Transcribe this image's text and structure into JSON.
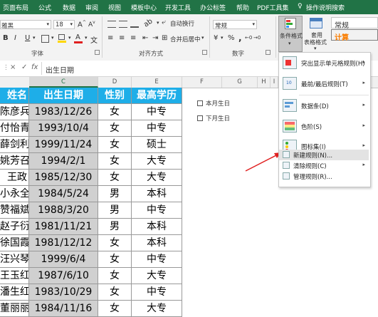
{
  "tabs": [
    "页面布局",
    "公式",
    "数据",
    "审阅",
    "视图",
    "模板中心",
    "开发工具",
    "办公标签",
    "帮助",
    "PDF工具集",
    "操作说明搜索"
  ],
  "ribbon": {
    "font_name": "雅黑",
    "font_size": "18",
    "bold": "B",
    "italic": "I",
    "underline": "U",
    "wrap_text": "自动换行",
    "merge_center": "合并后居中",
    "number_format": "常规",
    "percent": "%",
    "thousands": ",",
    "cond_format": "条件格式",
    "table_format_1": "套用",
    "table_format_2": "表格格式",
    "style_normal": "常规",
    "style_calc": "计算",
    "groups": {
      "font": "字体",
      "alignment": "对齐方式",
      "number": "数字"
    }
  },
  "formula_bar": {
    "x": "×",
    "check": "✓",
    "fx": "fx",
    "content": "出生日期"
  },
  "col_headers": [
    "C",
    "D",
    "E",
    "F",
    "G",
    "H",
    "I"
  ],
  "table": {
    "headers": [
      "姓名",
      "出生日期",
      "性别",
      "最高学历"
    ],
    "rows": [
      [
        "陈彦兵",
        "1983/12/26",
        "女",
        "中专"
      ],
      [
        "付怡青",
        "1993/10/4",
        "女",
        "中专"
      ],
      [
        "薛剑利",
        "1999/11/24",
        "女",
        "硕士"
      ],
      [
        "姚芳召",
        "1994/2/1",
        "女",
        "大专"
      ],
      [
        "王政",
        "1985/12/30",
        "女",
        "大专"
      ],
      [
        "小永全",
        "1984/5/24",
        "男",
        "本科"
      ],
      [
        "赞福斌",
        "1988/3/20",
        "男",
        "中专"
      ],
      [
        "赵子衍",
        "1981/11/21",
        "男",
        "本科"
      ],
      [
        "徐国霞",
        "1981/12/12",
        "女",
        "本科"
      ],
      [
        "汪兴琴",
        "1999/6/4",
        "女",
        "中专"
      ],
      [
        "王玉红",
        "1987/6/10",
        "女",
        "大专"
      ],
      [
        "潘生红",
        "1983/10/29",
        "女",
        "中专"
      ],
      [
        "董丽丽",
        "1984/11/16",
        "女",
        "大专"
      ]
    ]
  },
  "checkboxes": [
    "本月生日",
    "下月生日"
  ],
  "menu": {
    "items": [
      {
        "label": "突出显示单元格规则(H)",
        "arrow": "▸"
      },
      {
        "label": "最前/最后规则(T)",
        "arrow": "▸"
      },
      {
        "label": "数据条(D)",
        "arrow": "▸"
      },
      {
        "label": "色阶(S)",
        "arrow": "▸"
      },
      {
        "label": "图标集(I)",
        "arrow": "▸"
      },
      {
        "label": "新建规则(N)...",
        "arrow": ""
      },
      {
        "label": "清除规则(C)",
        "arrow": "▸"
      },
      {
        "label": "管理规则(R)...",
        "arrow": ""
      }
    ]
  },
  "colors": {
    "tab_bar": "#217346",
    "header_fill": "#1eaee8",
    "selected": "#d0d0d0",
    "arrow": "#e02020",
    "calc_text": "#fa7d00",
    "calc_fill": "#f2f2f2",
    "hover": "#e3e3e3"
  }
}
